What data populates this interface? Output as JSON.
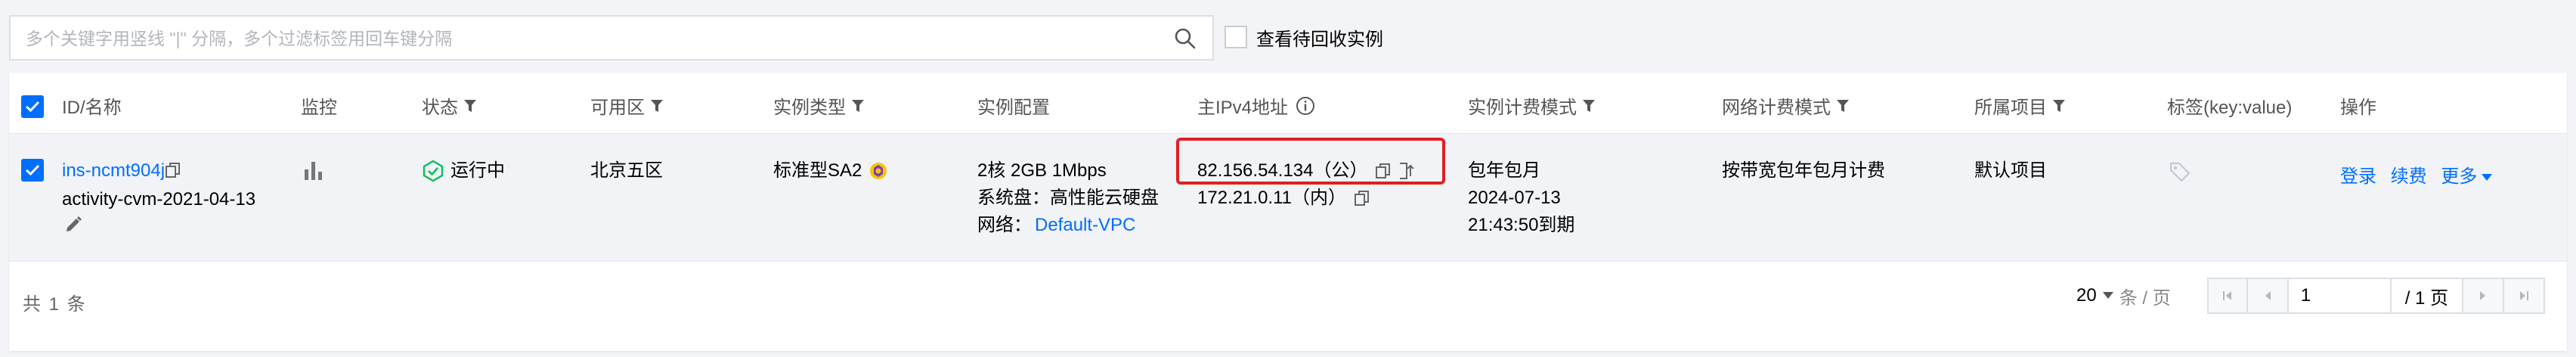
{
  "search": {
    "placeholder": "多个关键字用竖线 \"|\" 分隔，多个过滤标签用回车键分隔",
    "value": ""
  },
  "recycle_toggle": {
    "label": "查看待回收实例",
    "checked": false
  },
  "columns": {
    "id_name": "ID/名称",
    "monitor": "监控",
    "status": "状态",
    "zone": "可用区",
    "instance_type": "实例类型",
    "config": "实例配置",
    "ipv4": "主IPv4地址",
    "billing": "实例计费模式",
    "network_billing": "网络计费模式",
    "project": "所属项目",
    "tags": "标签(key:value)",
    "actions": "操作"
  },
  "row": {
    "selected": true,
    "instance_id": "ins-ncmt904j",
    "instance_name": "activity-cvm-2021-04-13",
    "status": "运行中",
    "zone": "北京五区",
    "instance_type": "标准型SA2",
    "config_spec": "2核 2GB 1Mbps",
    "system_disk": "系统盘：高性能云硬盘",
    "network_label": "网络：",
    "network_vpc": "Default-VPC",
    "public_ip": "82.156.54.134（公）",
    "private_ip": "172.21.0.11（内）",
    "billing_mode": "包年包月",
    "expire_date": "2024-07-13",
    "expire_time": "21:43:50到期",
    "network_billing": "按带宽包年包月计费",
    "project": "默认项目",
    "action_login": "登录",
    "action_renew": "续费",
    "action_more": "更多"
  },
  "footer": {
    "total": "共 1 条",
    "page_size": "20",
    "page_size_unit": "条 / 页",
    "current_page": "1",
    "total_pages": "/ 1 页"
  },
  "colors": {
    "accent": "#006eff",
    "running": "#0abf5b",
    "highlight_border": "#e02020"
  }
}
